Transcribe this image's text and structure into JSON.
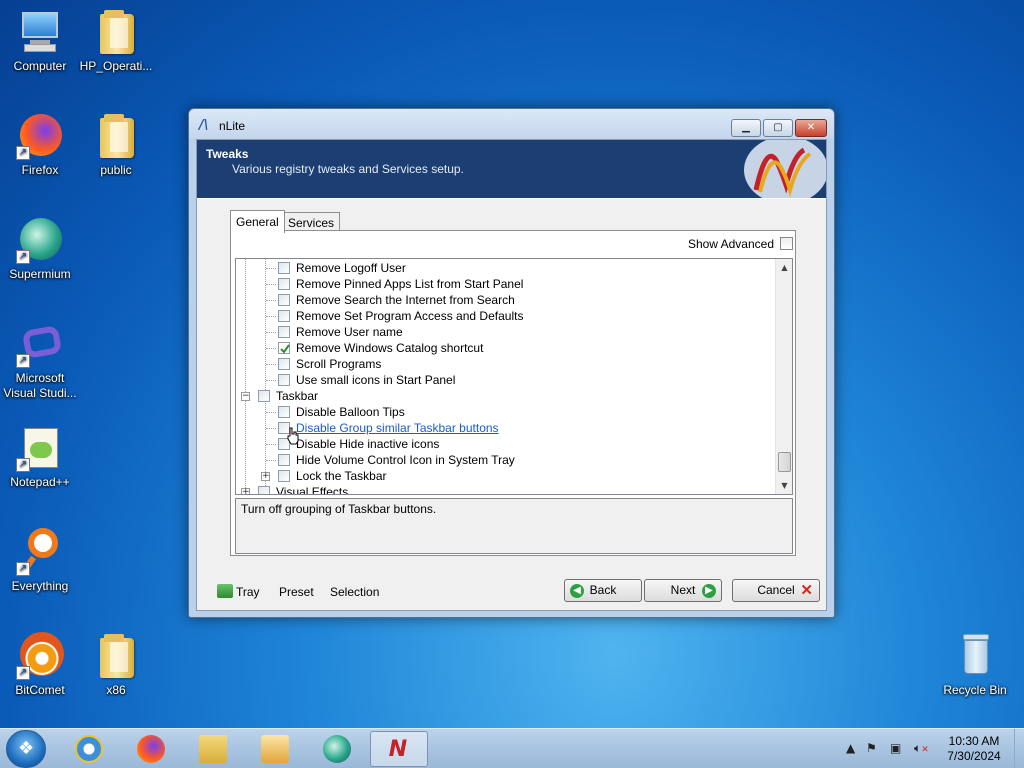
{
  "desktop": {
    "icons": [
      {
        "label": "Computer"
      },
      {
        "label": "HP_Operati..."
      },
      {
        "label": "Firefox"
      },
      {
        "label": "public"
      },
      {
        "label": "Supermium"
      },
      {
        "label": "Microsoft Visual Studi..."
      },
      {
        "label": "Notepad++"
      },
      {
        "label": "Everything"
      },
      {
        "label": "BitComet"
      },
      {
        "label": "x86"
      },
      {
        "label": "Recycle Bin"
      }
    ]
  },
  "window": {
    "title": "nLite",
    "header": {
      "title": "Tweaks",
      "subtitle": "Various registry tweaks and Services setup."
    },
    "tabs": [
      {
        "label": "General",
        "active": true
      },
      {
        "label": "Services",
        "active": false
      }
    ],
    "show_advanced_label": "Show Advanced",
    "tree": {
      "items": [
        {
          "label": "Remove Logoff User",
          "checked": false
        },
        {
          "label": "Remove Pinned Apps List from Start Panel",
          "checked": false
        },
        {
          "label": "Remove Search the Internet from Search",
          "checked": false
        },
        {
          "label": "Remove Set Program Access and Defaults",
          "checked": false
        },
        {
          "label": "Remove User name",
          "checked": false
        },
        {
          "label": "Remove Windows Catalog shortcut",
          "checked": true
        },
        {
          "label": "Scroll Programs",
          "checked": false
        },
        {
          "label": "Use small icons in Start Panel",
          "checked": false
        },
        {
          "label": "Taskbar",
          "checked": false
        },
        {
          "label": "Disable Balloon Tips",
          "checked": false
        },
        {
          "label": "Disable Group similar Taskbar buttons",
          "checked": false,
          "hovered": true
        },
        {
          "label": "Disable Hide inactive icons",
          "checked": false
        },
        {
          "label": "Hide Volume Control Icon in System Tray",
          "checked": false
        },
        {
          "label": "Lock the Taskbar",
          "checked": false
        },
        {
          "label": "Visual Effects",
          "checked": false
        }
      ]
    },
    "description": "Turn off grouping of Taskbar buttons.",
    "footer": {
      "tray": "Tray",
      "preset": "Preset",
      "selection": "Selection",
      "back": "Back",
      "next": "Next",
      "cancel": "Cancel"
    }
  },
  "taskbar": {
    "apps": [
      "start",
      "internet-explorer",
      "firefox",
      "file-explorer",
      "media-player",
      "supermium",
      "nlite"
    ],
    "clock": {
      "time": "10:30 AM",
      "date": "7/30/2024"
    }
  },
  "colors": {
    "header_bg": "#1c3e72",
    "link": "#1a5cc6",
    "close_button": "#c7402a"
  }
}
